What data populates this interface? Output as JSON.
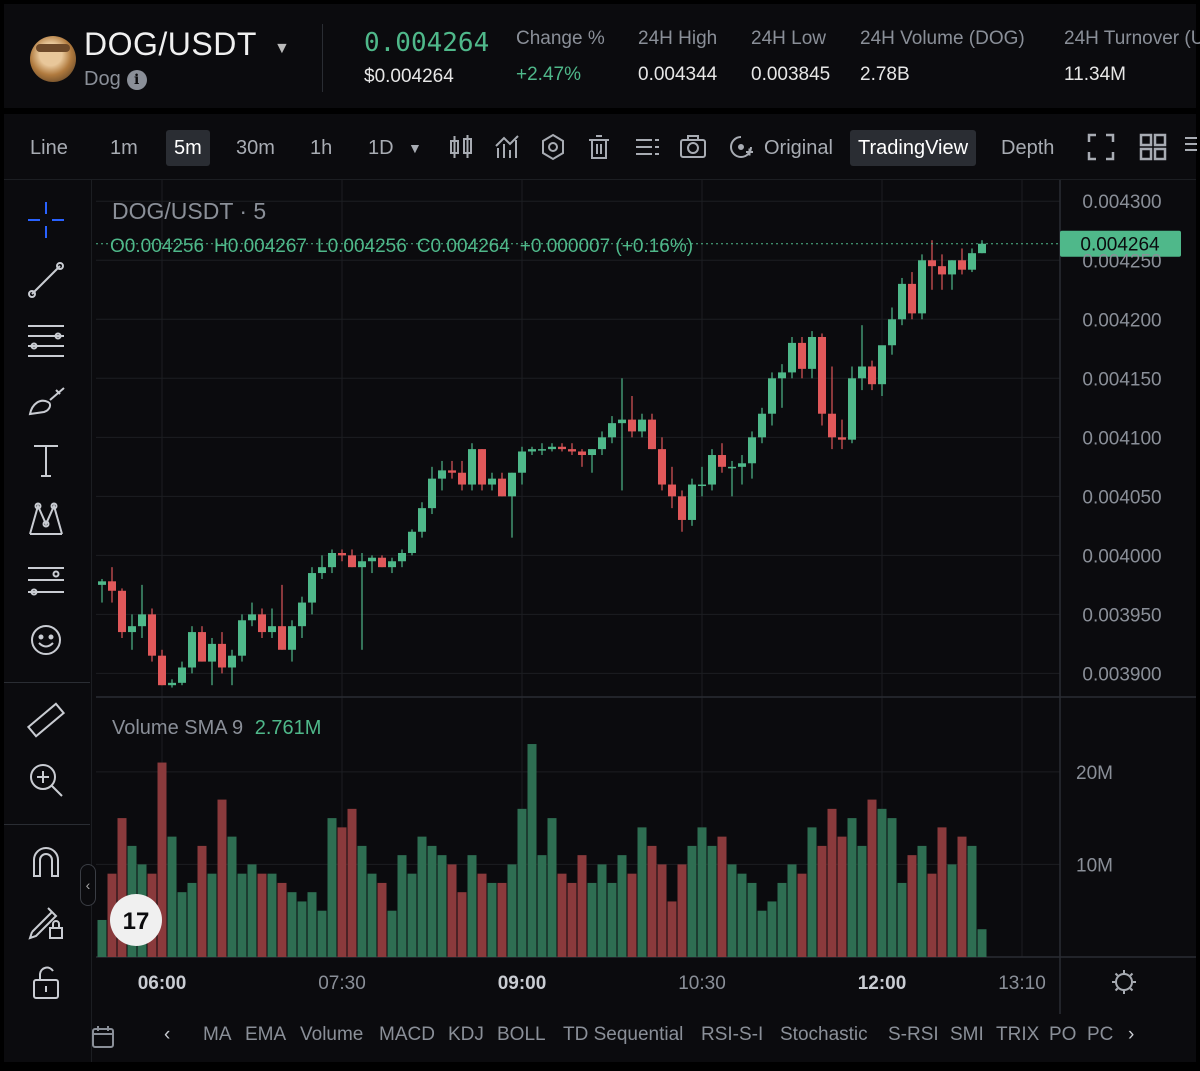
{
  "header": {
    "pair": "DOG/USDT",
    "name": "Dog",
    "last_price": "0.004264",
    "last_price_usd": "$0.004264",
    "stats": [
      {
        "label": "Change %",
        "value": "+2.47%",
        "positive": true
      },
      {
        "label": "24H High",
        "value": "0.004344"
      },
      {
        "label": "24H Low",
        "value": "0.003845"
      },
      {
        "label": "24H Volume (DOG)",
        "value": "2.78B"
      },
      {
        "label": "24H Turnover (U",
        "value": "11.34M"
      }
    ]
  },
  "toolbar": {
    "line": "Line",
    "intervals": [
      "1m",
      "5m",
      "30m",
      "1h",
      "1D"
    ],
    "active_interval": "5m",
    "views": [
      "Original",
      "TradingView",
      "Depth"
    ],
    "active_view": "TradingView"
  },
  "chart_data": {
    "type": "candlestick",
    "title": "DOG/USDT · 5",
    "ohlc_label": {
      "o": "O0.004256",
      "h": "H0.004267",
      "l": "L0.004256",
      "c": "C0.004264",
      "change": "+0.000007 (+0.16%)"
    },
    "current_price_label": "0.004264",
    "current_price": 0.004264,
    "price_ticks": [
      "0.004300",
      "0.004250",
      "0.004200",
      "0.004150",
      "0.004100",
      "0.004050",
      "0.004000",
      "0.003950",
      "0.003900"
    ],
    "price_tick_values": [
      0.0043,
      0.00425,
      0.0042,
      0.00415,
      0.0041,
      0.00405,
      0.004,
      0.00395,
      0.0039
    ],
    "price_range": [
      0.00388,
      0.004318
    ],
    "time_ticks": [
      {
        "label": "06:00",
        "bold": true,
        "index": 6
      },
      {
        "label": "07:30",
        "bold": false,
        "index": 24
      },
      {
        "label": "09:00",
        "bold": true,
        "index": 42
      },
      {
        "label": "10:30",
        "bold": false,
        "index": 60
      },
      {
        "label": "12:00",
        "bold": true,
        "index": 78
      },
      {
        "label": "13:10",
        "bold": false,
        "index": 92
      }
    ],
    "grid": true,
    "candles": [
      [
        0.003975,
        0.00398,
        0.00396,
        0.003978
      ],
      [
        0.003978,
        0.00399,
        0.00396,
        0.00397
      ],
      [
        0.00397,
        0.003972,
        0.00393,
        0.003935
      ],
      [
        0.003935,
        0.00395,
        0.00392,
        0.00394
      ],
      [
        0.00394,
        0.003975,
        0.00393,
        0.00395
      ],
      [
        0.00395,
        0.003955,
        0.00391,
        0.003915
      ],
      [
        0.003915,
        0.00392,
        0.00389,
        0.00389
      ],
      [
        0.00389,
        0.003895,
        0.003888,
        0.003892
      ],
      [
        0.003892,
        0.00391,
        0.00389,
        0.003905
      ],
      [
        0.003905,
        0.00394,
        0.0039,
        0.003935
      ],
      [
        0.003935,
        0.00394,
        0.00391,
        0.00391
      ],
      [
        0.00391,
        0.00393,
        0.00389,
        0.003925
      ],
      [
        0.003925,
        0.003935,
        0.0039,
        0.003905
      ],
      [
        0.003905,
        0.00392,
        0.00389,
        0.003915
      ],
      [
        0.003915,
        0.00395,
        0.00391,
        0.003945
      ],
      [
        0.003945,
        0.00396,
        0.00394,
        0.00395
      ],
      [
        0.00395,
        0.003955,
        0.00393,
        0.003935
      ],
      [
        0.003935,
        0.003955,
        0.00393,
        0.00394
      ],
      [
        0.00394,
        0.003975,
        0.00392,
        0.00392
      ],
      [
        0.00392,
        0.003945,
        0.00391,
        0.00394
      ],
      [
        0.00394,
        0.003965,
        0.00393,
        0.00396
      ],
      [
        0.00396,
        0.00399,
        0.00395,
        0.003985
      ],
      [
        0.003985,
        0.004,
        0.00398,
        0.00399
      ],
      [
        0.00399,
        0.004005,
        0.003985,
        0.004002
      ],
      [
        0.004002,
        0.004005,
        0.003995,
        0.004
      ],
      [
        0.004,
        0.004005,
        0.00399,
        0.00399
      ],
      [
        0.00399,
        0.004002,
        0.00392,
        0.003995
      ],
      [
        0.003995,
        0.004,
        0.003985,
        0.003998
      ],
      [
        0.003998,
        0.004,
        0.00399,
        0.00399
      ],
      [
        0.00399,
        0.003998,
        0.003985,
        0.003995
      ],
      [
        0.003995,
        0.004005,
        0.00399,
        0.004002
      ],
      [
        0.004002,
        0.004022,
        0.004,
        0.00402
      ],
      [
        0.00402,
        0.004045,
        0.004015,
        0.00404
      ],
      [
        0.00404,
        0.004075,
        0.004035,
        0.004065
      ],
      [
        0.004065,
        0.00408,
        0.004055,
        0.004072
      ],
      [
        0.004072,
        0.00408,
        0.004065,
        0.00407
      ],
      [
        0.00407,
        0.00408,
        0.004055,
        0.00406
      ],
      [
        0.00406,
        0.004095,
        0.004055,
        0.00409
      ],
      [
        0.00409,
        0.00409,
        0.004055,
        0.00406
      ],
      [
        0.00406,
        0.00407,
        0.004055,
        0.004065
      ],
      [
        0.004065,
        0.00407,
        0.00405,
        0.00405
      ],
      [
        0.00405,
        0.00407,
        0.004015,
        0.00407
      ],
      [
        0.00407,
        0.004092,
        0.00406,
        0.004088
      ],
      [
        0.004088,
        0.004092,
        0.004085,
        0.00409
      ],
      [
        0.00409,
        0.004095,
        0.004085,
        0.00409
      ],
      [
        0.00409,
        0.004095,
        0.004088,
        0.004092
      ],
      [
        0.004092,
        0.004095,
        0.004088,
        0.00409
      ],
      [
        0.00409,
        0.004095,
        0.004085,
        0.004088
      ],
      [
        0.004088,
        0.00409,
        0.004075,
        0.004085
      ],
      [
        0.004085,
        0.00409,
        0.00407,
        0.00409
      ],
      [
        0.00409,
        0.004105,
        0.004085,
        0.0041
      ],
      [
        0.0041,
        0.004118,
        0.004095,
        0.004112
      ],
      [
        0.004112,
        0.00415,
        0.004055,
        0.004115
      ],
      [
        0.004115,
        0.004135,
        0.0041,
        0.004105
      ],
      [
        0.004105,
        0.00412,
        0.0041,
        0.004115
      ],
      [
        0.004115,
        0.00412,
        0.00409,
        0.00409
      ],
      [
        0.00409,
        0.0041,
        0.004055,
        0.00406
      ],
      [
        0.00406,
        0.004075,
        0.00404,
        0.00405
      ],
      [
        0.00405,
        0.004055,
        0.00402,
        0.00403
      ],
      [
        0.00403,
        0.004065,
        0.004025,
        0.00406
      ],
      [
        0.00406,
        0.004075,
        0.00405,
        0.00406
      ],
      [
        0.00406,
        0.00409,
        0.004055,
        0.004085
      ],
      [
        0.004085,
        0.004095,
        0.00407,
        0.004075
      ],
      [
        0.004075,
        0.00408,
        0.00405,
        0.004075
      ],
      [
        0.004075,
        0.004085,
        0.00406,
        0.004078
      ],
      [
        0.004078,
        0.004105,
        0.004065,
        0.0041
      ],
      [
        0.0041,
        0.004125,
        0.004095,
        0.00412
      ],
      [
        0.00412,
        0.004155,
        0.00411,
        0.00415
      ],
      [
        0.00415,
        0.004162,
        0.004125,
        0.004155
      ],
      [
        0.004155,
        0.004185,
        0.00415,
        0.00418
      ],
      [
        0.00418,
        0.004185,
        0.00415,
        0.004158
      ],
      [
        0.004158,
        0.00419,
        0.00415,
        0.004185
      ],
      [
        0.004185,
        0.004188,
        0.00411,
        0.00412
      ],
      [
        0.00412,
        0.00416,
        0.00409,
        0.0041
      ],
      [
        0.0041,
        0.004115,
        0.00409,
        0.004098
      ],
      [
        0.004098,
        0.00416,
        0.004095,
        0.00415
      ],
      [
        0.00415,
        0.004195,
        0.00414,
        0.00416
      ],
      [
        0.00416,
        0.004165,
        0.00414,
        0.004145
      ],
      [
        0.004145,
        0.004175,
        0.004135,
        0.004178
      ],
      [
        0.004178,
        0.00421,
        0.00417,
        0.0042
      ],
      [
        0.0042,
        0.004235,
        0.004195,
        0.00423
      ],
      [
        0.00423,
        0.00424,
        0.0042,
        0.004205
      ],
      [
        0.004205,
        0.004255,
        0.0042,
        0.00425
      ],
      [
        0.00425,
        0.004267,
        0.004225,
        0.004245
      ],
      [
        0.004245,
        0.004255,
        0.004225,
        0.004238
      ],
      [
        0.004238,
        0.00425,
        0.004225,
        0.00425
      ],
      [
        0.00425,
        0.00426,
        0.004238,
        0.004242
      ],
      [
        0.004242,
        0.00426,
        0.00424,
        0.004256
      ],
      [
        0.004256,
        0.004267,
        0.004256,
        0.004264
      ]
    ],
    "volume": {
      "label": "Volume SMA 9",
      "sma_value": "2.761M",
      "ticks": [
        "20M",
        "10M"
      ],
      "tick_values": [
        20,
        10
      ],
      "max": 27,
      "values_m": [
        4,
        9,
        15,
        12,
        10,
        9,
        21,
        13,
        7,
        8,
        12,
        9,
        17,
        13,
        9,
        10,
        9,
        9,
        8,
        7,
        6,
        7,
        5,
        15,
        14,
        16,
        12,
        9,
        8,
        5,
        11,
        9,
        13,
        12,
        11,
        10,
        7,
        11,
        9,
        8,
        8,
        10,
        16,
        23,
        11,
        15,
        9,
        8,
        11,
        8,
        10,
        8,
        11,
        9,
        14,
        12,
        10,
        6,
        10,
        12,
        14,
        12,
        13,
        10,
        9,
        8,
        5,
        6,
        8,
        10,
        9,
        14,
        12,
        16,
        13,
        15,
        12,
        17,
        16,
        15,
        8,
        11,
        12,
        9,
        14,
        10,
        13,
        12,
        3
      ]
    }
  },
  "bottom_indicators": [
    "MA",
    "EMA",
    "Volume",
    "MACD",
    "KDJ",
    "BOLL",
    "TD Sequential",
    "RSI-S-I",
    "Stochastic",
    "S-RSI",
    "SMI",
    "TRIX",
    "PO",
    "PC"
  ],
  "colors": {
    "up": "#4fb88a",
    "down": "#e0585a",
    "background": "#0b0b0e",
    "grid": "#1c1e22",
    "accent_blue": "#2962ff"
  }
}
